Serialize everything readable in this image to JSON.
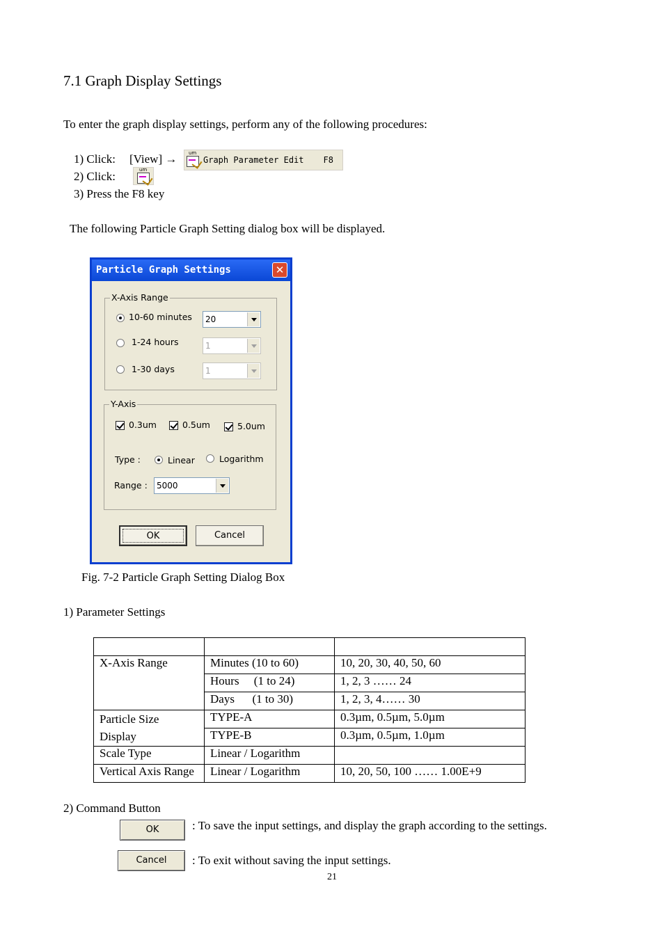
{
  "section_title": "7.1 Graph Display Settings",
  "intro": "To enter the graph display settings, perform any of the following procedures:",
  "procedures": {
    "step1_label": "1) Click:",
    "step1_menu": "[View] →",
    "menu_item_label": "Graph Parameter Edit",
    "menu_item_shortcut": "F8",
    "icon_caption": "um",
    "step2_label": "2) Click:",
    "step3": "3) Press the F8 key"
  },
  "dialog_intro": "The following Particle Graph Setting dialog box will be displayed.",
  "dialog": {
    "title": "Particle Graph Settings",
    "close_glyph": "✕",
    "x_axis_group": "X-Axis Range",
    "x_options": [
      {
        "label": "10-60 minutes",
        "value": "20",
        "selected": true
      },
      {
        "label": "1-24 hours",
        "value": "1",
        "selected": false
      },
      {
        "label": "1-30 days",
        "value": "1",
        "selected": false
      }
    ],
    "y_axis_group": "Y-Axis",
    "y_checks": [
      {
        "label": "0.3um",
        "checked": true
      },
      {
        "label": "0.5um",
        "checked": true
      },
      {
        "label": "5.0um",
        "checked": true
      }
    ],
    "type_label": "Type :",
    "type_linear": "Linear",
    "type_log": "Logarithm",
    "range_label": "Range :",
    "range_value": "5000",
    "ok_label": "OK",
    "cancel_label": "Cancel"
  },
  "figure_caption": "Fig. 7-2 Particle Graph Setting Dialog Box",
  "param_heading": "1) Parameter Settings",
  "table": {
    "rows": [
      [
        "X-Axis Range",
        "Minutes (10 to 60)",
        "10, 20, 30, 40, 50, 60"
      ],
      [
        "",
        "Hours  (1 to 24)",
        "1, 2, 3 …… 24"
      ],
      [
        "",
        "Days  (1 to 30)",
        "1, 2, 3, 4…… 30"
      ],
      [
        "Particle Size",
        "TYPE-A",
        "0.3µm, 0.5µm, 5.0µm"
      ],
      [
        "Display",
        "TYPE-B",
        "0.3µm, 0.5µm, 1.0µm"
      ],
      [
        "Scale Type",
        "Linear / Logarithm",
        ""
      ],
      [
        "Vertical Axis Range",
        "Linear / Logarithm",
        "10, 20, 50, 100 …… 1.00E+9"
      ]
    ]
  },
  "command_heading": "2) Command Button",
  "commands": {
    "ok_label": "OK",
    "ok_desc": ": To save the input settings, and display the graph according to the settings.",
    "cancel_label": "Cancel",
    "cancel_desc": ": To exit without saving the input settings."
  },
  "page_number": "21"
}
